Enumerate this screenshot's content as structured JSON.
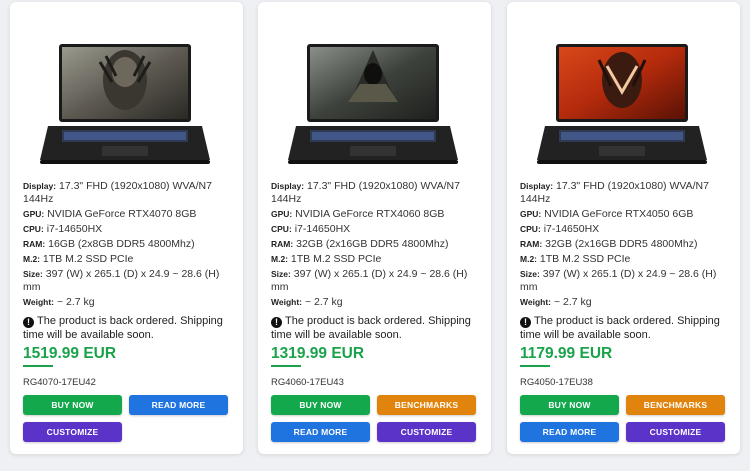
{
  "products": [
    {
      "specs": {
        "display_label": "Display:",
        "display": "17.3\" FHD (1920x1080) WVA/N7 144Hz",
        "gpu_label": "GPU:",
        "gpu": "NVIDIA GeForce RTX4070 8GB",
        "cpu_label": "CPU:",
        "cpu": "i7-14650HX",
        "ram_label": "RAM:",
        "ram": "16GB (2x8GB DDR5 4800Mhz)",
        "m2_label": "M.2:",
        "m2": "1TB M.2 SSD PCIe",
        "size_label": "Size:",
        "size": "397 (W) x 265.1 (D) x 24.9 ~ 28.6 (H) mm",
        "weight_label": "Weight:",
        "weight": "~ 2.7 kg"
      },
      "backorder": "The product is back ordered. Shipping time will be available soon.",
      "price": "1519.99 EUR",
      "sku": "RG4070-17EU42",
      "buttons": {
        "buy_now": "BUY NOW",
        "read_more": "READ MORE",
        "customize": "CUSTOMIZE"
      },
      "screen_theme": "predator-bw"
    },
    {
      "specs": {
        "display_label": "Display:",
        "display": "17.3\" FHD (1920x1080) WVA/N7 144Hz",
        "gpu_label": "GPU:",
        "gpu": "NVIDIA GeForce RTX4060 8GB",
        "cpu_label": "CPU:",
        "cpu": "i7-14650HX",
        "ram_label": "RAM:",
        "ram": "32GB (2x16GB DDR5 4800Mhz)",
        "m2_label": "M.2:",
        "m2": "1TB M.2 SSD PCIe",
        "size_label": "Size:",
        "size": "397 (W) x 265.1 (D) x 24.9 ~ 28.6 (H) mm",
        "weight_label": "Weight:",
        "weight": "~ 2.7 kg"
      },
      "backorder": "The product is back ordered. Shipping time will be available soon.",
      "price": "1319.99 EUR",
      "sku": "RG4060-17EU43",
      "buttons": {
        "buy_now": "BUY NOW",
        "benchmarks": "BENCHMARKS",
        "read_more": "READ MORE",
        "customize": "CUSTOMIZE"
      },
      "screen_theme": "hooded-warrior"
    },
    {
      "specs": {
        "display_label": "Display:",
        "display": "17.3\" FHD (1920x1080) WVA/N7 144Hz",
        "gpu_label": "GPU:",
        "gpu": "NVIDIA GeForce RTX4050 6GB",
        "cpu_label": "CPU:",
        "cpu": "i7-14650HX",
        "ram_label": "RAM:",
        "ram": "32GB (2x16GB DDR5 4800Mhz)",
        "m2_label": "M.2:",
        "m2": "1TB M.2 SSD PCIe",
        "size_label": "Size:",
        "size": "397 (W) x 265.1 (D) x 24.9 ~ 28.6 (H) mm",
        "weight_label": "Weight:",
        "weight": "~ 2.7 kg"
      },
      "backorder": "The product is back ordered. Shipping time will be available soon.",
      "price": "1179.99 EUR",
      "sku": "RG4050-17EU38",
      "buttons": {
        "buy_now": "BUY NOW",
        "benchmarks": "BENCHMARKS",
        "read_more": "READ MORE",
        "customize": "CUSTOMIZE"
      },
      "screen_theme": "predator-red"
    }
  ],
  "colors": {
    "price": "#1aa34a",
    "buy_now": "#13a84b",
    "read_more": "#1f74e0",
    "customize": "#5b33c9",
    "benchmarks": "#e0840d"
  },
  "icons": {
    "backorder": "exclamation-circle-icon"
  }
}
